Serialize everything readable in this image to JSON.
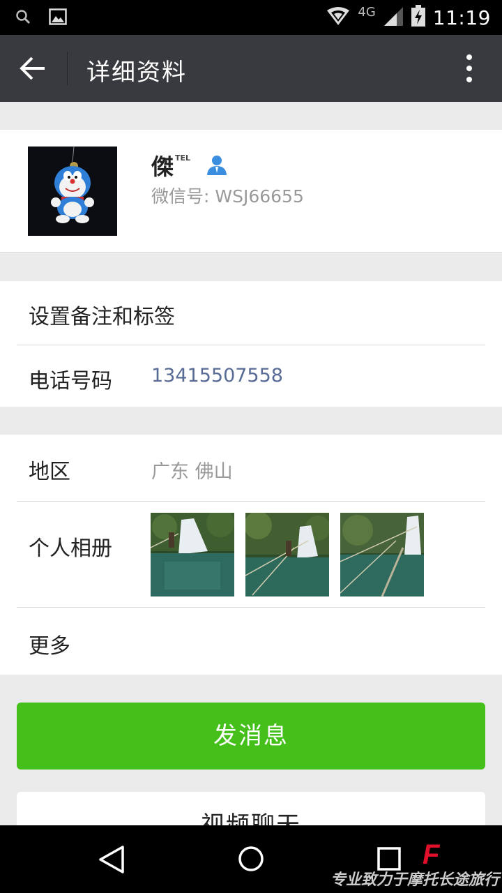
{
  "status_bar": {
    "time": "11:19",
    "network": "4G",
    "icons": [
      "search-icon",
      "image-icon",
      "wifi-icon",
      "signal-icon",
      "battery-charging-icon"
    ]
  },
  "toolbar": {
    "title": "详细资料",
    "back_icon": "arrow-left-icon",
    "more_icon": "more-vertical-icon"
  },
  "profile": {
    "name": "傑",
    "tag": "TEL",
    "wechat_id": "微信号: WSJ66655",
    "contact_icon": "person-icon"
  },
  "section1": {
    "remark_label": "设置备注和标签",
    "phone_label": "电话号码",
    "phone_value": "13415507558"
  },
  "section2": {
    "region_label": "地区",
    "region_value": "广东  佛山",
    "album_label": "个人相册",
    "more_label": "更多"
  },
  "actions": {
    "send_message": "发消息",
    "video_chat": "视频聊天"
  },
  "nav_bar": {
    "watermark": "专业致力于摩托长途旅行",
    "watermark_mark": "F"
  },
  "colors": {
    "toolbar": "#393a3f",
    "accent_green": "#45c01a",
    "phone_blue": "#576b95",
    "secondary_text": "#999999"
  }
}
